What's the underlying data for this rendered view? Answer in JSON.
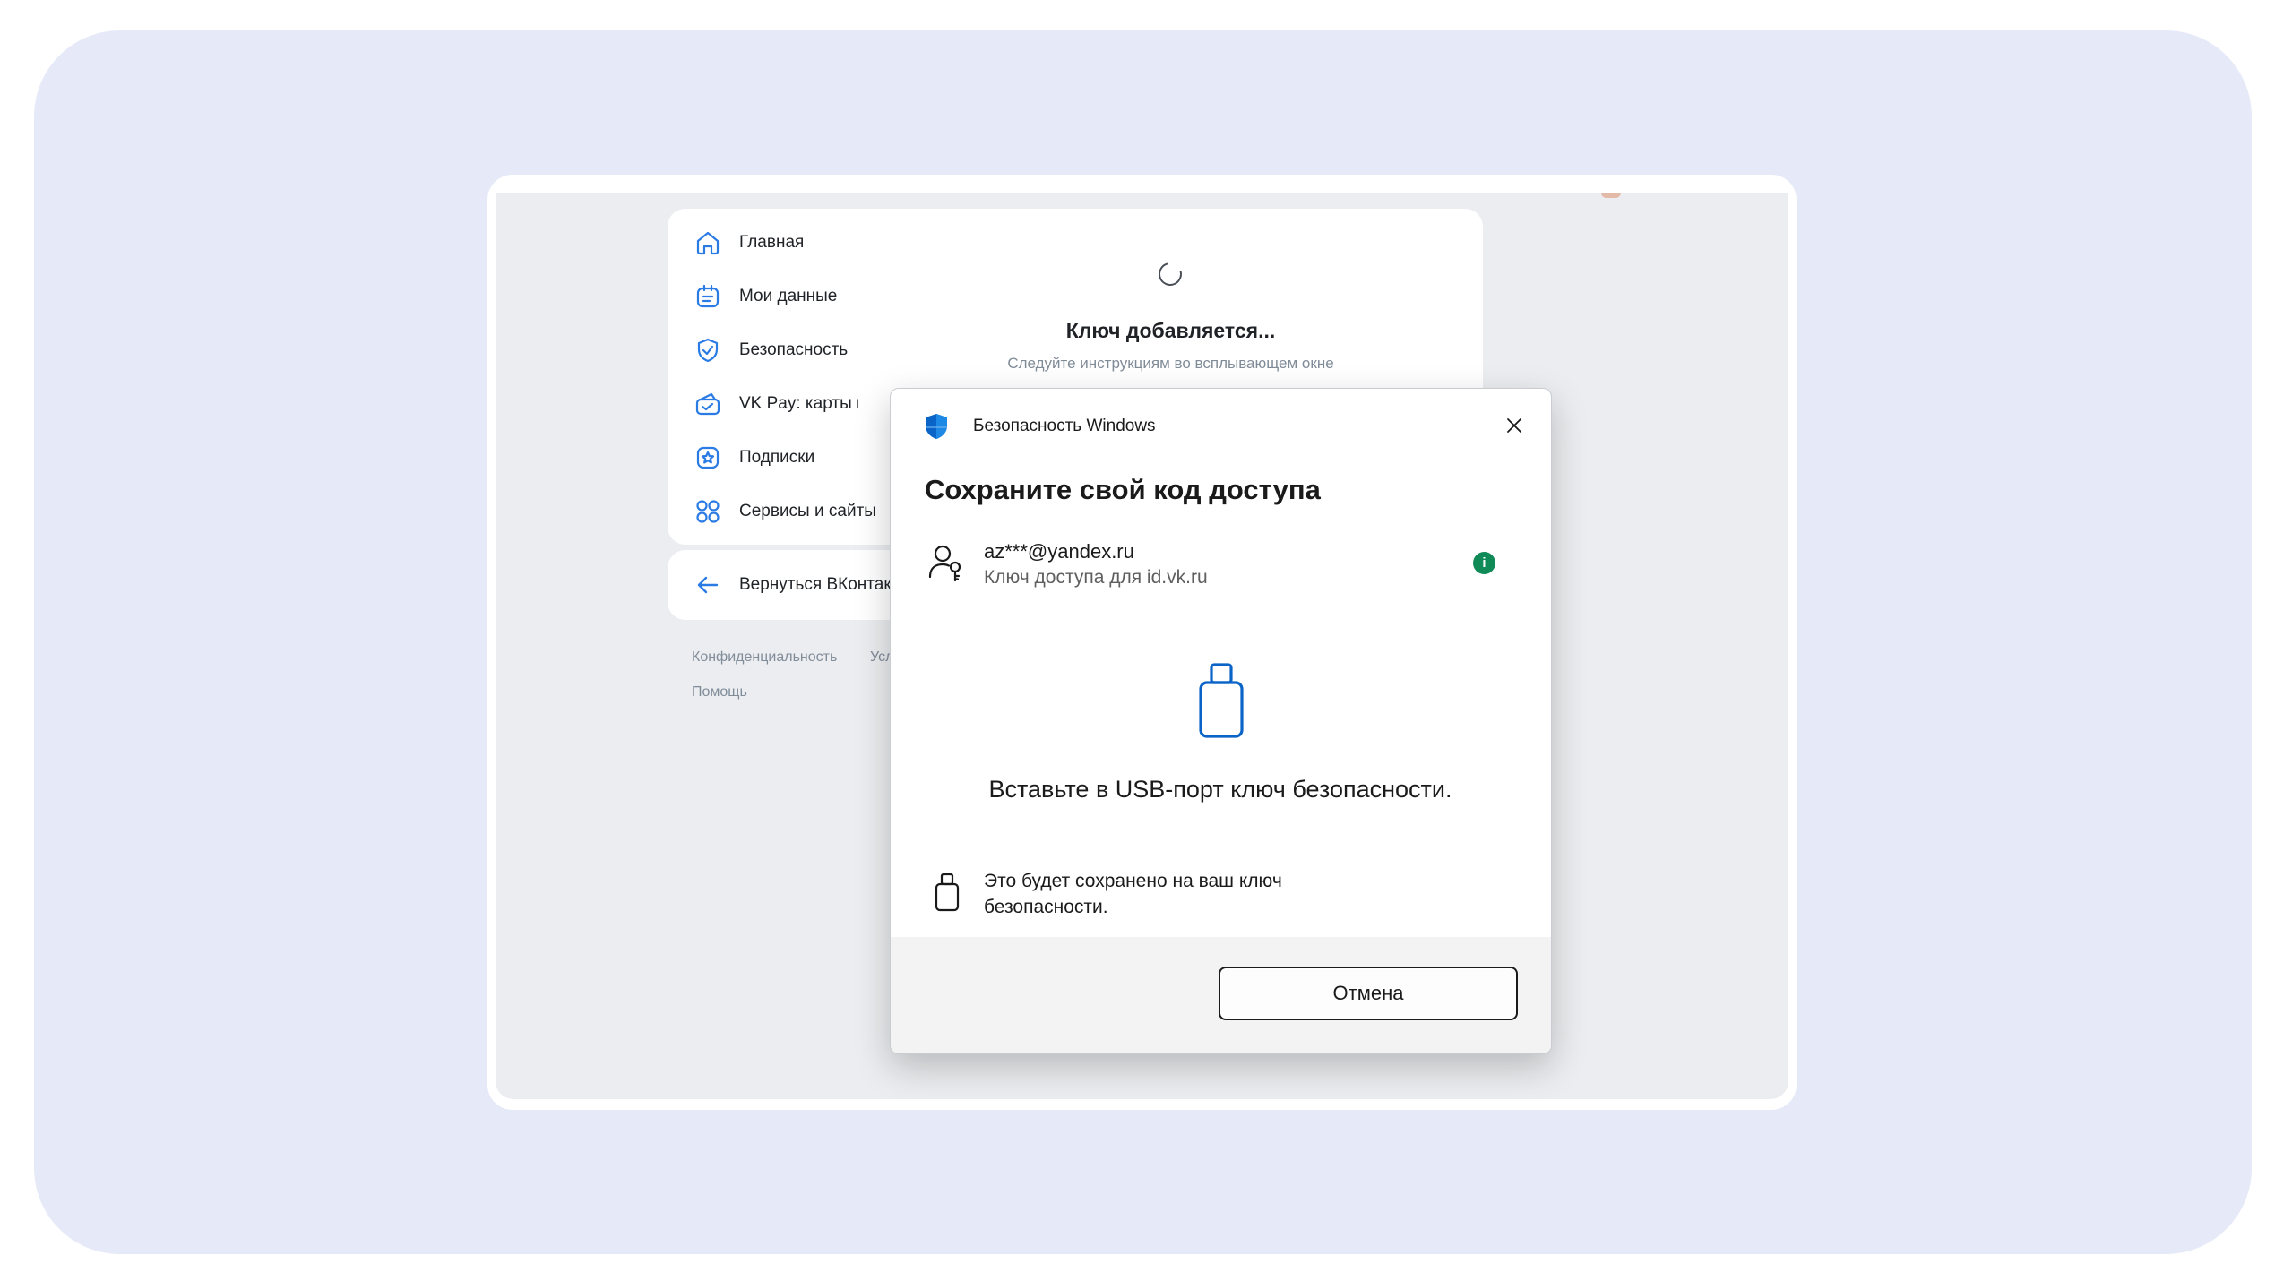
{
  "sidebar": {
    "items": [
      {
        "label": "Главная",
        "icon": "home-icon"
      },
      {
        "label": "Мои данные",
        "icon": "id-card-icon"
      },
      {
        "label": "Безопасность",
        "icon": "shield-icon"
      },
      {
        "label": "VK Pay: карты и плат",
        "icon": "wallet-icon"
      },
      {
        "label": "Подписки",
        "icon": "star-icon"
      },
      {
        "label": "Сервисы и сайты",
        "icon": "apps-grid-icon"
      }
    ],
    "back_label": "Вернуться ВКонтакте",
    "footer": {
      "privacy": "Конфиденциальность",
      "terms": "Усл",
      "help": "Помощь"
    }
  },
  "status": {
    "title": "Ключ добавляется...",
    "subtitle": "Следуйте инструкциям во всплывающем окне"
  },
  "dialog": {
    "window_title": "Безопасность Windows",
    "heading": "Сохраните свой код доступа",
    "account_email": "az***@yandex.ru",
    "account_sub": "Ключ доступа для id.vk.ru",
    "info_glyph": "i",
    "instruction": "Вставьте в USB-порт ключ безопасности.",
    "note": "Это будет сохранено на ваш ключ безопасности.",
    "cancel_label": "Отмена"
  },
  "colors": {
    "accent": "#2a7be4",
    "windows_blue": "#0a64c8",
    "info_green": "#108a57",
    "muted_text": "#818c99"
  }
}
